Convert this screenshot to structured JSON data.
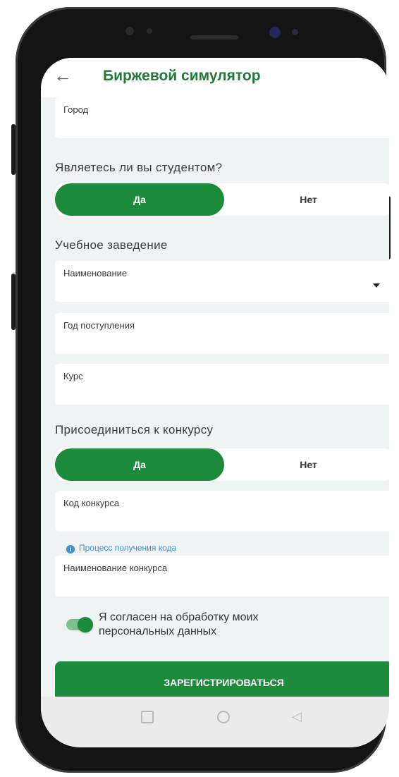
{
  "header": {
    "back_icon": "arrow-left-icon",
    "title": "Биржевой симулятор"
  },
  "city_field": {
    "label": "Город",
    "value": ""
  },
  "student": {
    "question": "Являетесь ли вы студентом?",
    "yes_label": "Да",
    "no_label": "Нет",
    "selected": "Да"
  },
  "education": {
    "section_title": "Учебное заведение",
    "name_label": "Наименование",
    "year_label": "Год поступления",
    "course_label": "Курс"
  },
  "contest": {
    "section_title": "Присоединиться к конкурсу",
    "yes_label": "Да",
    "no_label": "Нет",
    "selected": "Да",
    "code_label": "Код конкурса",
    "info_link": "Процесс получения кода",
    "name_label": "Наименование конкурса"
  },
  "consent": {
    "text": "Я согласен на обработку моих персональных данных",
    "checked": true
  },
  "submit": {
    "label": "ЗАРЕГИСТРИРОВАТЬСЯ"
  },
  "colors": {
    "accent": "#1d8b3c",
    "title": "#1e7a33",
    "link": "#3d8fd6",
    "background": "#f0f3f4"
  }
}
